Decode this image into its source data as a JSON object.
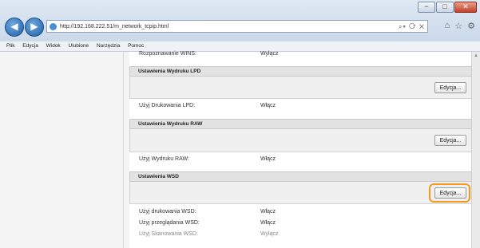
{
  "browser": {
    "address": "http://192.168.222.51/m_network_tcpip.html",
    "menu": [
      "Plik",
      "Edycja",
      "Widok",
      "Ulubione",
      "Narzędzia",
      "Pomoc"
    ],
    "window_buttons": [
      "−",
      "□",
      "✕"
    ]
  },
  "content": {
    "top_row": {
      "label": "Rozpoznawanie WINS:",
      "value": "Wyłącz"
    },
    "sections": [
      {
        "title": "Ustawienia Wydruku LPD",
        "button": "Edycja...",
        "row_label": "Użyj Drukowania LPD:",
        "row_value": "Włącz"
      },
      {
        "title": "Ustawienia Wydruku RAW",
        "button": "Edycja...",
        "row_label": "Użyj Wydruku RAW:",
        "row_value": "Włącz"
      },
      {
        "title": "Ustawienia WSD",
        "button": "Edycja..."
      }
    ],
    "wsd_rows": [
      {
        "label": "Użyj drukowania WSD:",
        "value": "Włącz"
      },
      {
        "label": "Użyj przeglądania WSD:",
        "value": "Włącz"
      },
      {
        "label": "Użyj Skanowania WSD:",
        "value": "Wyłącz"
      }
    ]
  },
  "colors": {
    "highlight": "#f39a1e",
    "section_header": "#e2e2e2"
  }
}
